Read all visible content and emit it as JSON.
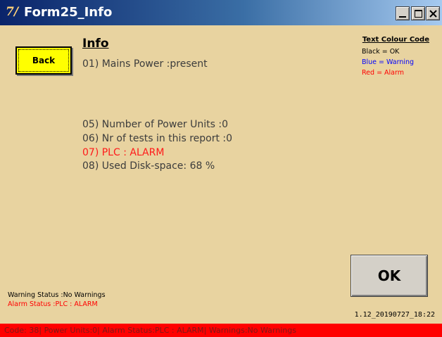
{
  "window": {
    "title": "Form25_Info",
    "icon_glyph": "7/"
  },
  "controls": {
    "minimize_icon": "minimize-icon",
    "maximize_icon": "maximize-icon",
    "close_icon": "close-icon"
  },
  "content": {
    "heading": "Info",
    "back_label": "Back",
    "lines": [
      "01) Mains Power :present",
      "05) Number of Power Units :0",
      "06) Nr of tests in this report :0",
      "07) PLC : ALARM",
      "08) Used Disk-space: 68 %"
    ]
  },
  "legend": {
    "title": "Text Colour Code",
    "black": "Black = OK",
    "blue": "Blue = Warning",
    "red": "Red = Alarm"
  },
  "ok_label": "OK",
  "status": {
    "warning": "Warning Status :No Warnings",
    "alarm": "Alarm Status :PLC : ALARM"
  },
  "version": "1.12_20190727_18:22",
  "bottom_bar": "Code: 38| Power Units:0| Alarm Status:PLC : ALARM| Warnings:No Warnings",
  "colors": {
    "background": "#e8d3a0",
    "ok": "#000000",
    "warning": "#0000ff",
    "alarm": "#ff0000",
    "back_button": "#ffff00"
  }
}
